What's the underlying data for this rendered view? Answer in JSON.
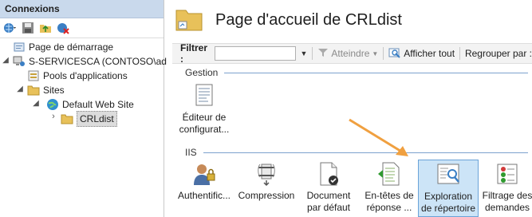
{
  "connections": {
    "title": "Connexions",
    "tree": {
      "start_page": "Page de démarrage",
      "server": "S-SERVICESCA (CONTOSO\\ad",
      "app_pools": "Pools d'applications",
      "sites": "Sites",
      "default_site": "Default Web Site",
      "crldist": "CRLdist"
    }
  },
  "main": {
    "title": "Page d'accueil de CRLdist",
    "filter": {
      "label": "Filtrer :",
      "go_label": "Atteindre",
      "show_all_label": "Afficher tout",
      "group_by_label": "Regrouper par :"
    },
    "groups": {
      "gestion": "Gestion",
      "iis": "IIS"
    },
    "features": {
      "config_editor": [
        "Éditeur de",
        "configurat..."
      ],
      "authentication": [
        "Authentific..."
      ],
      "compression": [
        "Compression"
      ],
      "default_document": [
        "Document",
        "par défaut"
      ],
      "response_headers": [
        "En-têtes de",
        "réponse ..."
      ],
      "directory_browsing": [
        "Exploration",
        "de répertoire"
      ],
      "request_filtering": [
        "Filtrage des",
        "demandes"
      ]
    }
  },
  "colors": {
    "header_bg": "#c9d9ec",
    "selection_bg": "#cce4f7",
    "arrow": "#f0a040"
  }
}
